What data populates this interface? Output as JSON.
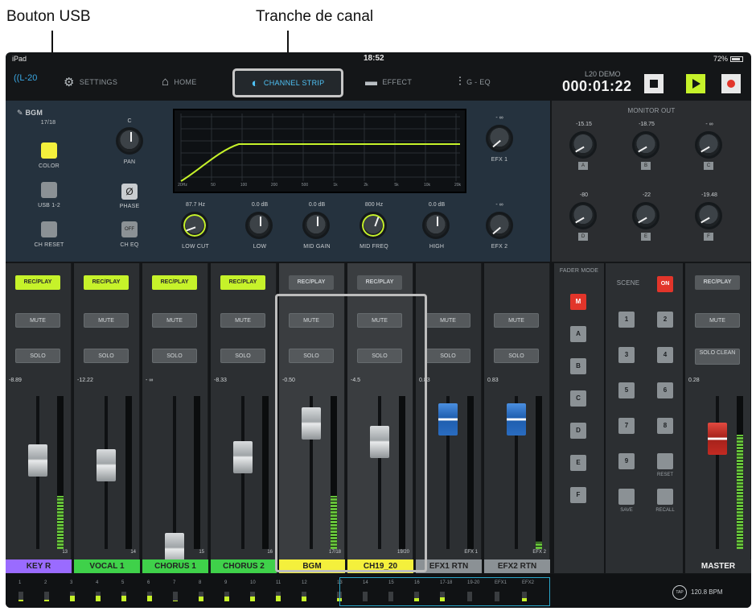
{
  "callouts": {
    "usb": "Bouton USB",
    "strip": "Tranche de canal"
  },
  "status": {
    "left": "iPad",
    "time": "18:52",
    "right": "72%"
  },
  "nav": {
    "logo": "L-20",
    "settings": "SETTINGS",
    "home": "HOME",
    "channel_strip": "CHANNEL STRIP",
    "effect": "EFFECT",
    "geq": "G - EQ"
  },
  "project": {
    "name": "L20 DEMO",
    "timer": "000:01:22"
  },
  "strip": {
    "channel": "BGM",
    "channel_num": "17/18",
    "color": "COLOR",
    "usb": "USB 1-2",
    "ch_reset": "CH RESET",
    "pan_val": "C",
    "pan": "PAN",
    "phase": "PHASE",
    "ch_eq": "CH EQ",
    "off": "OFF",
    "efx1_val": "- ∞",
    "efx1": "EFX 1",
    "efx2_val": "- ∞",
    "efx2": "EFX 2",
    "lowcut_val": "87.7 Hz",
    "lowcut": "LOW CUT",
    "low_val": "0.0 dB",
    "low": "LOW",
    "midgain_val": "0.0 dB",
    "midgain": "MID GAIN",
    "midfreq_val": "800 Hz",
    "midfreq": "MID FREQ",
    "high_val": "0.0 dB",
    "high": "HIGH",
    "eq_x_ticks": [
      "20Hz",
      "50",
      "100",
      "200",
      "500",
      "1k",
      "2k",
      "5k",
      "10k",
      "20k"
    ]
  },
  "monitor": {
    "title": "MONITOR OUT",
    "knobs": [
      {
        "val": "-15.15",
        "label": "A"
      },
      {
        "val": "-18.75",
        "label": "B"
      },
      {
        "val": "- ∞",
        "label": "C"
      },
      {
        "val": "-80",
        "label": "D"
      },
      {
        "val": "-22",
        "label": "E"
      },
      {
        "val": "-19.48",
        "label": "F"
      }
    ]
  },
  "buttons": {
    "rec_play": "REC/PLAY",
    "mute": "MUTE",
    "solo": "SOLO",
    "solo_clean": "SOLO CLEAN"
  },
  "channels": [
    {
      "name": "KEY R",
      "val": "-8.89",
      "num": "13",
      "rp": "on",
      "color": "#9a6bff",
      "level": 0.58,
      "meter": 0.35
    },
    {
      "name": "VOCAL 1",
      "val": "-12.22",
      "num": "14",
      "rp": "on",
      "color": "#3fd14a",
      "level": 0.55,
      "meter": 0.0
    },
    {
      "name": "CHORUS 1",
      "val": "- ∞",
      "num": "15",
      "rp": "on",
      "color": "#3fd14a",
      "level": 0.0,
      "meter": 0.0
    },
    {
      "name": "CHORUS 2",
      "val": "-8.33",
      "num": "16",
      "rp": "on",
      "color": "#3fd14a",
      "level": 0.6,
      "meter": 0.0
    },
    {
      "name": "BGM",
      "val": "-0.50",
      "num": "17/18",
      "rp": "off",
      "color": "#f4f03c",
      "level": 0.82,
      "meter": 0.35
    },
    {
      "name": "CH19_20",
      "val": "-4.5",
      "num": "19/20",
      "rp": "off",
      "color": "#f4f03c",
      "level": 0.7,
      "meter": 0.0
    },
    {
      "name": "EFX1 RTN",
      "val": "0.83",
      "num": "EFX 1",
      "rp": "none",
      "color": "#8b9195",
      "level": 0.85,
      "meter": 0.0
    },
    {
      "name": "EFX2 RTN",
      "val": "0.83",
      "num": "EFX 2",
      "rp": "none",
      "color": "#8b9195",
      "level": 0.85,
      "meter": 0.05
    }
  ],
  "fader_mode": {
    "title": "FADER MODE",
    "items": [
      "M",
      "A",
      "B",
      "C",
      "D",
      "E",
      "F"
    ]
  },
  "scene": {
    "title": "SCENE",
    "on": "ON",
    "numbers": [
      "1",
      "2",
      "3",
      "4",
      "5",
      "6",
      "7",
      "8",
      "9"
    ],
    "reset": "RESET",
    "save": "SAVE",
    "recall": "RECALL"
  },
  "master": {
    "name": "MASTER",
    "val": "0.28",
    "level": 0.72,
    "meter": 0.75
  },
  "bottom": {
    "labels": [
      "1",
      "2",
      "3",
      "4",
      "5",
      "6",
      "7",
      "8",
      "9",
      "10",
      "11",
      "12",
      "13",
      "14",
      "15",
      "16",
      "17-18",
      "19-20",
      "EFX1",
      "EFX2"
    ],
    "levels": [
      0.2,
      0.15,
      0.6,
      0.6,
      0.6,
      0.6,
      0.1,
      0.5,
      0.5,
      0.5,
      0.6,
      0.5,
      0.3,
      0.0,
      0.0,
      0.3,
      0.4,
      0.0,
      0.0,
      0.3
    ],
    "tap": "TAP",
    "bpm": "120.8 BPM"
  },
  "colors": {
    "accent": "#c6f22a",
    "active_nav": "#4fc3f7",
    "record": "#e2352a"
  }
}
